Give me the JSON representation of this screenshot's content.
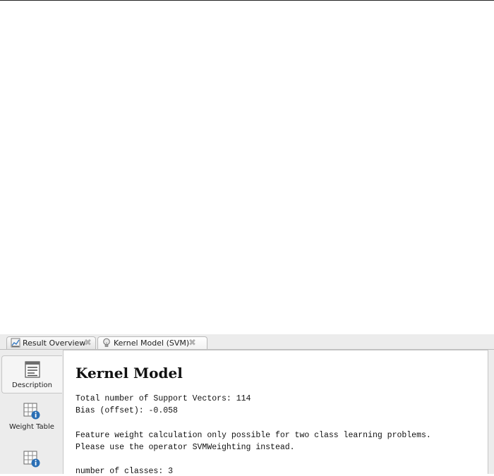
{
  "tabs": [
    {
      "label": "Result Overview",
      "icon": "chart-icon"
    },
    {
      "label": "Kernel Model (SVM)",
      "icon": "lightbulb-icon"
    }
  ],
  "sidebar": {
    "items": [
      {
        "label": "Description",
        "icon": "text-document-icon"
      },
      {
        "label": "Weight Table",
        "icon": "table-info-icon"
      },
      {
        "label": "",
        "icon": "table-info-icon"
      }
    ]
  },
  "content": {
    "title": "Kernel Model",
    "lines": [
      "Total number of Support Vectors: 114",
      "Bias (offset): -0.058",
      "Feature weight calculation only possible for two class learning problems.",
      "Please use the operator SVMWeighting instead.",
      "number of classes: 3"
    ]
  },
  "colors": {
    "panel_bg": "#ececec",
    "border": "#c6c6c6",
    "info_blue": "#2a6fb5"
  }
}
